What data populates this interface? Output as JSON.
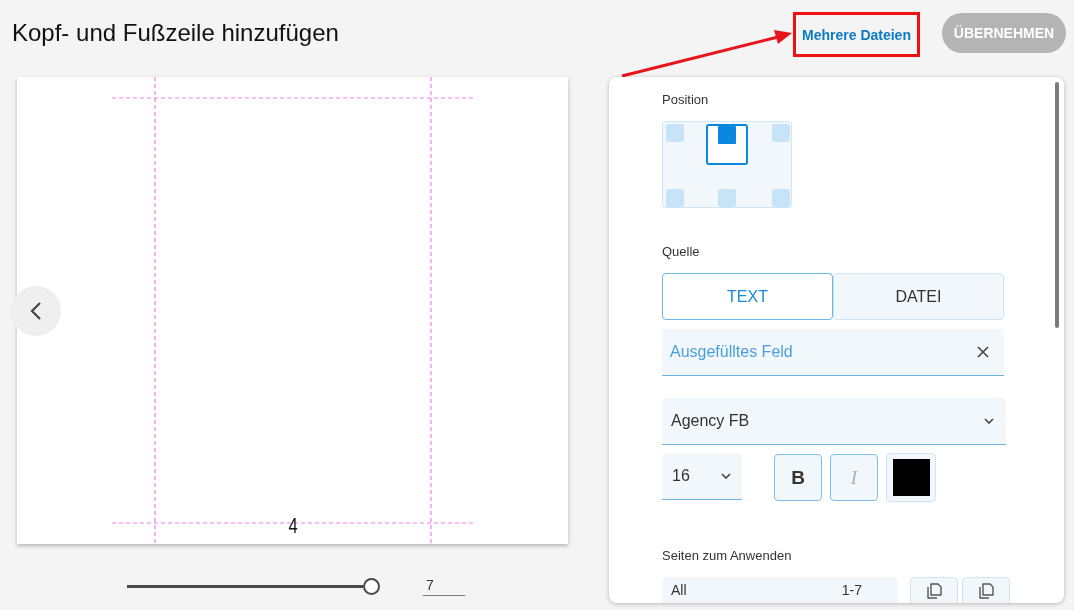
{
  "header": {
    "title": "Kopf- und Fußzeile hinzufügen",
    "link": "Mehrere Dateien",
    "apply_button": {
      "label": "ÜBERNEHMEN",
      "disabled": true
    }
  },
  "preview": {
    "page_number": "4",
    "page_slider": {
      "level": 1
    },
    "page_count": "7"
  },
  "settings": {
    "position": {
      "label": "Position",
      "slots": [
        {
          "selected": false
        },
        {
          "selected": true
        },
        {
          "selected": false
        },
        {
          "selected": false
        },
        {
          "selected": false
        },
        {
          "selected": false
        }
      ]
    },
    "source": {
      "label": "Quelle",
      "tabs": [
        {
          "label": "TEXT",
          "selected": true
        },
        {
          "label": "DATEI",
          "selected": false
        }
      ],
      "text_field": {
        "value": "Ausgefülltes Feld"
      }
    },
    "font": {
      "family": "Agency FB",
      "size": "16",
      "styles": [
        {
          "label": "B",
          "kind": "bold",
          "disabled": false
        },
        {
          "label": "I",
          "kind": "italic",
          "disabled": true
        }
      ],
      "color": "#000000"
    },
    "pages": {
      "label": "Seiten zum Anwenden",
      "scope": "All",
      "range": "1-7"
    }
  }
}
